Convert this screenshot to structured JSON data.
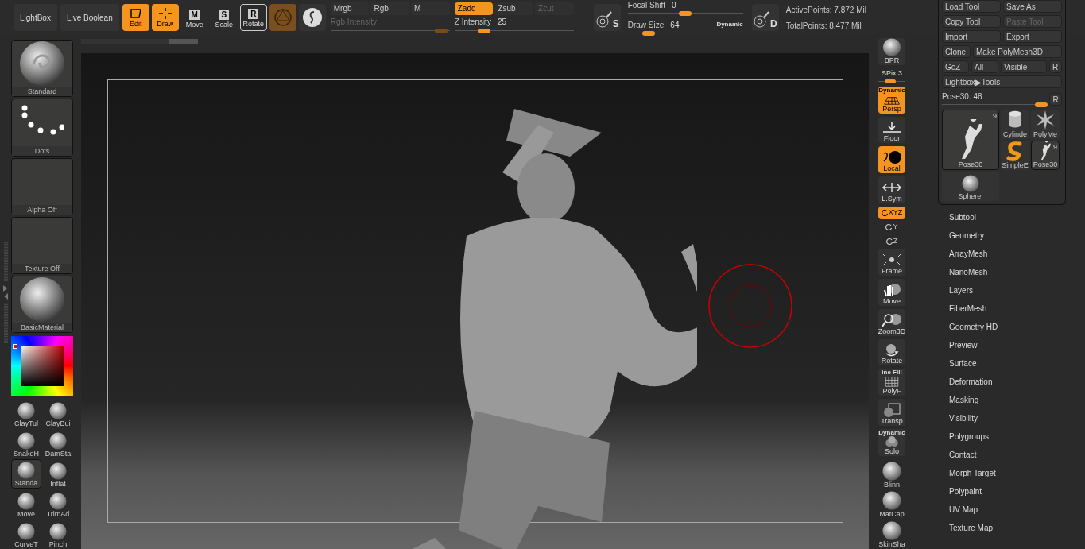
{
  "top_toolbar": {
    "mode_buttons": [
      {
        "label": "LightBox"
      },
      {
        "label": "Live Boolean"
      }
    ],
    "draw_modes": [
      {
        "label": "Edit",
        "on": true
      },
      {
        "label": "Draw",
        "on": true
      }
    ],
    "transform_buttons": [
      {
        "label": "Move",
        "key": "M",
        "selected": false
      },
      {
        "label": "Scale",
        "key": "S",
        "selected": false
      },
      {
        "label": "Rotate",
        "key": "R",
        "selected": true
      }
    ],
    "channel_modes": [
      {
        "label": "Mrgb",
        "selected": false,
        "disabled": false
      },
      {
        "label": "Rgb",
        "selected": false,
        "disabled": false
      },
      {
        "label": "M",
        "selected": false,
        "disabled": false
      }
    ],
    "sculpt_modes": [
      {
        "label": "Zadd",
        "selected": true,
        "disabled": false
      },
      {
        "label": "Zsub",
        "selected": false,
        "disabled": false
      },
      {
        "label": "Zcut",
        "selected": false,
        "disabled": true
      }
    ],
    "rgb_intensity": {
      "label": "Rgb Intensity",
      "disabled": true,
      "level": 0.93
    },
    "z_intensity": {
      "label": "Z Intensity",
      "value": "25",
      "disabled": false,
      "level": 0.25
    },
    "stroke_button": {
      "letter": "S"
    },
    "focal_shift": {
      "label": "Focal Shift",
      "value": "0",
      "level": 0.5
    },
    "draw_size": {
      "label": "Draw Size",
      "value": "64",
      "level": 0.18
    },
    "dynamic": {
      "label": "Dynamic",
      "on": true
    },
    "draw_button": {
      "letter": "D"
    },
    "stats": [
      "ActivePoints: 7.872 Mil",
      "TotalPoints: 8.477 Mil"
    ]
  },
  "left_shelf": {
    "slots": [
      {
        "kind": "brush",
        "label": "Standard"
      },
      {
        "kind": "stroke",
        "label": "Dots"
      },
      {
        "kind": "empty",
        "label": "Alpha Off"
      },
      {
        "kind": "empty",
        "label": "Texture Off"
      },
      {
        "kind": "material",
        "label": "BasicMaterial"
      }
    ],
    "brushes": [
      {
        "label": "ClayTul",
        "selected": false
      },
      {
        "label": "ClayBui",
        "selected": false
      },
      {
        "label": "SnakeH",
        "selected": false
      },
      {
        "label": "DamSta",
        "selected": false
      },
      {
        "label": "Standa",
        "selected": true
      },
      {
        "label": "Inflat",
        "selected": false
      },
      {
        "label": "Move",
        "selected": false
      },
      {
        "label": "TrimAd",
        "selected": false
      },
      {
        "label": "CurveT",
        "selected": false
      },
      {
        "label": "Pinch",
        "selected": false
      }
    ]
  },
  "right_toolbar": [
    {
      "kind": "button",
      "label": "BPR",
      "on": false
    },
    {
      "kind": "slider",
      "label": "SPix",
      "value": "3",
      "level": 0.45
    },
    {
      "kind": "button",
      "label": "Persp",
      "on": true,
      "top": "Dynamic"
    },
    {
      "kind": "button",
      "label": "Floor",
      "on": false
    },
    {
      "kind": "button",
      "label": "Local",
      "on": true
    },
    {
      "kind": "button",
      "label": "L.Sym",
      "on": false
    },
    {
      "kind": "axis",
      "label": "XYZ",
      "on": true
    },
    {
      "kind": "axis",
      "label": "Y",
      "on": false
    },
    {
      "kind": "axis",
      "label": "Z",
      "on": false
    },
    {
      "kind": "button",
      "label": "Frame",
      "on": false
    },
    {
      "kind": "button",
      "label": "Move",
      "on": false
    },
    {
      "kind": "button",
      "label": "Zoom3D",
      "on": false
    },
    {
      "kind": "button",
      "label": "Rotate",
      "on": false
    },
    {
      "kind": "button",
      "label": "PolyF",
      "on": false,
      "top": "ine Fill"
    },
    {
      "kind": "button",
      "label": "Transp",
      "on": false
    },
    {
      "kind": "button",
      "label": "Solo",
      "on": false,
      "top": "Dynamic"
    },
    {
      "kind": "material",
      "label": "Blinn"
    },
    {
      "kind": "material",
      "label": "MatCap"
    },
    {
      "kind": "material",
      "label": "SkinSha"
    }
  ],
  "tool_panel": {
    "button_rows": [
      [
        {
          "label": "Load Tool",
          "disabled": false
        },
        {
          "label": "Save As",
          "disabled": false
        }
      ],
      [
        {
          "label": "Copy Tool",
          "disabled": false
        },
        {
          "label": "Paste Tool",
          "disabled": true
        }
      ],
      [
        {
          "label": "Import",
          "disabled": false
        },
        {
          "label": "Export",
          "disabled": false
        }
      ],
      [
        {
          "label": "Clone",
          "disabled": false
        },
        {
          "label": "Make PolyMesh3D",
          "disabled": false
        }
      ],
      [
        {
          "label": "GoZ",
          "disabled": false
        },
        {
          "label": "All",
          "disabled": false
        },
        {
          "label": "Visible",
          "disabled": false
        },
        {
          "label": "R",
          "disabled": false
        }
      ],
      [
        {
          "label": "Lightbox▶Tools",
          "disabled": false
        }
      ]
    ],
    "tool_slider": {
      "label": "Pose30. 48",
      "level": 0.95,
      "reset": "R"
    },
    "tools": [
      {
        "kind": "figure",
        "label": "Pose30",
        "count": "9",
        "selected": true
      },
      {
        "kind": "cylinder",
        "label": "Cylinde",
        "selected": false
      },
      {
        "kind": "star",
        "label": "PolyMe",
        "selected": false
      },
      {
        "kind": "snake",
        "label": "SimpleE",
        "selected": false
      },
      {
        "kind": "figure",
        "label": "Pose30",
        "count": "9",
        "selected": true
      },
      {
        "kind": "sphere",
        "label": "Sphere:",
        "selected": false
      }
    ]
  },
  "menu": [
    "Subtool",
    "Geometry",
    "ArrayMesh",
    "NanoMesh",
    "Layers",
    "FiberMesh",
    "Geometry HD",
    "Preview",
    "Surface",
    "Deformation",
    "Masking",
    "Visibility",
    "Polygroups",
    "Contact",
    "Morph Target",
    "Polypaint",
    "UV Map",
    "Texture Map"
  ]
}
